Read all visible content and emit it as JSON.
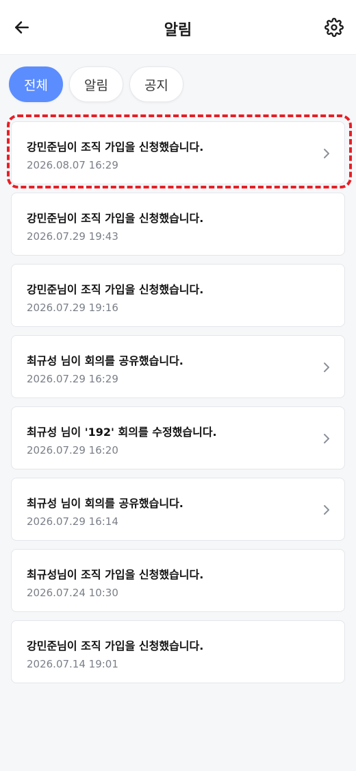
{
  "header": {
    "title": "알림"
  },
  "tabs": [
    {
      "label": "전체",
      "active": true
    },
    {
      "label": "알림",
      "active": false
    },
    {
      "label": "공지",
      "active": false
    }
  ],
  "notifications": [
    {
      "title": "강민준님이 조직 가입을 신청했습니다.",
      "time": "2026.08.07 16:29",
      "chevron": true
    },
    {
      "title": "강민준님이 조직 가입을 신청했습니다.",
      "time": "2026.07.29 19:43",
      "chevron": false
    },
    {
      "title": "강민준님이 조직 가입을 신청했습니다.",
      "time": "2026.07.29 19:16",
      "chevron": false
    },
    {
      "title": "최규성 님이 회의를 공유했습니다.",
      "time": "2026.07.29 16:29",
      "chevron": true
    },
    {
      "title": "최규성 님이 '192' 회의를 수정했습니다.",
      "time": "2026.07.29 16:20",
      "chevron": true
    },
    {
      "title": "최규성 님이 회의를 공유했습니다.",
      "time": "2026.07.29 16:14",
      "chevron": true
    },
    {
      "title": "최규성님이 조직 가입을 신청했습니다.",
      "time": "2026.07.24 10:30",
      "chevron": false
    },
    {
      "title": "강민준님이 조직 가입을 신청했습니다.",
      "time": "2026.07.14 19:01",
      "chevron": false
    }
  ],
  "colors": {
    "accent": "#5b8dff",
    "highlight": "#e81e25",
    "time_text": "#7a7f87"
  },
  "icons": {
    "back": "arrow-left-icon",
    "settings": "gear-icon",
    "chevron": "chevron-right-icon"
  }
}
